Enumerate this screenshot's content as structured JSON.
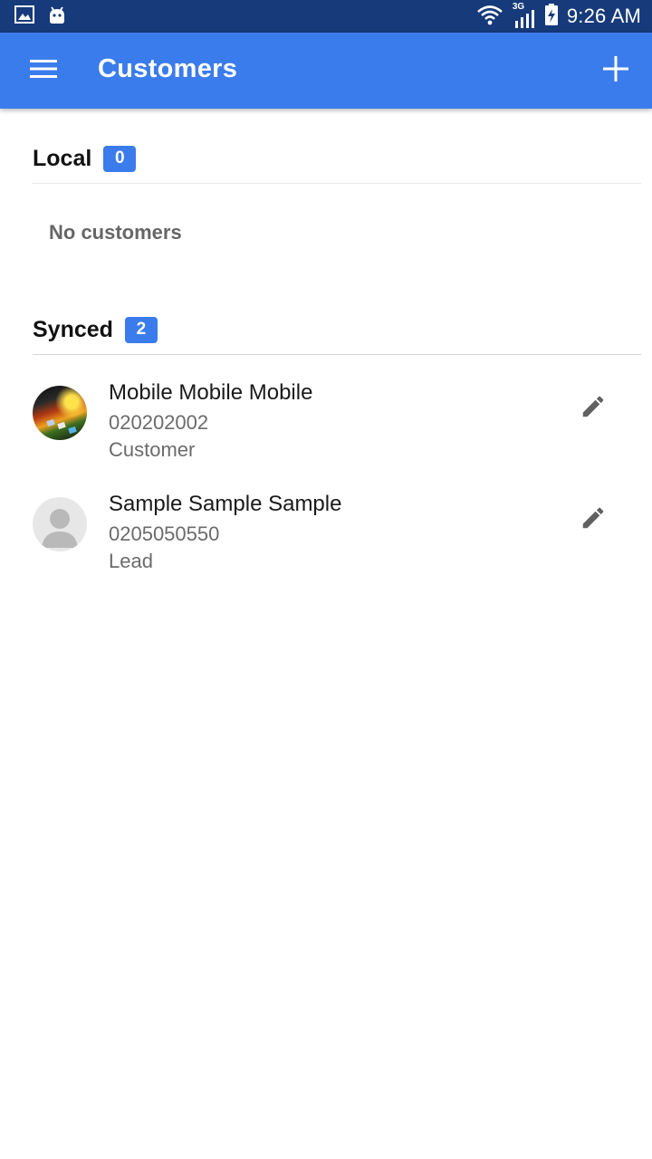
{
  "status_bar": {
    "time": "9:26 AM",
    "network_label": "3G",
    "icons": [
      "image-icon",
      "android-icon",
      "wifi-icon",
      "signal-icon",
      "battery-charging-icon"
    ]
  },
  "app_bar": {
    "title": "Customers",
    "menu_icon": "hamburger-menu-icon",
    "add_icon": "plus-icon"
  },
  "sections": {
    "local": {
      "title": "Local",
      "count": "0",
      "empty_text": "No customers"
    },
    "synced": {
      "title": "Synced",
      "count": "2"
    }
  },
  "customers": [
    {
      "name": "Mobile Mobile Mobile",
      "phone": "020202002",
      "type": "Customer",
      "avatar": "photo"
    },
    {
      "name": "Sample Sample Sample",
      "phone": "0205050550",
      "type": "Lead",
      "avatar": "default-person"
    }
  ],
  "colors": {
    "status_bar": "#163a7a",
    "primary": "#3b7cec",
    "badge": "#3b7cec",
    "secondary_text": "#6b6b6b",
    "icon": "#616161"
  }
}
